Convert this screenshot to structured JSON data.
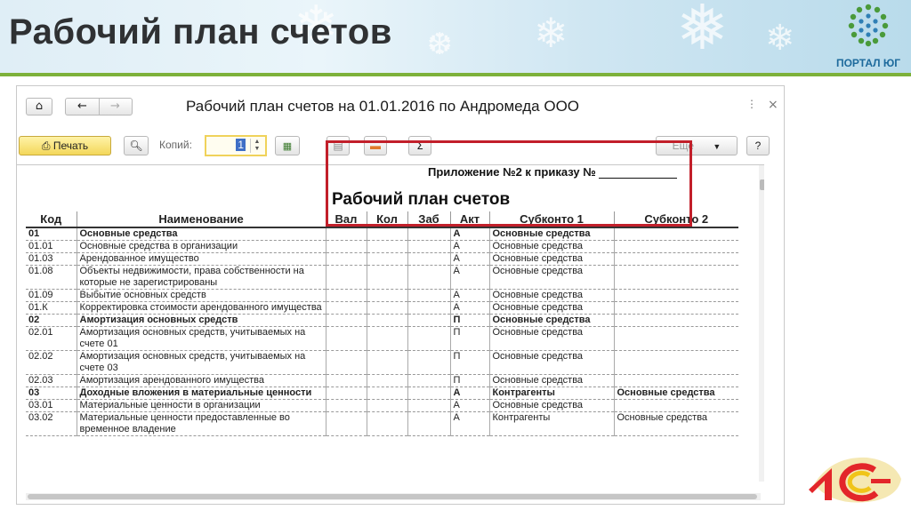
{
  "slide": {
    "title": "Рабочий план счетов",
    "logo_text": "ПОРТАЛ ЮГ",
    "brand_logo_text": "1С",
    "colors": {
      "title": "#2f3133",
      "accent_line": "#7db13a",
      "highlight": "#c21f2a"
    }
  },
  "window": {
    "title": "Рабочий план счетов на 01.01.2016 по Андромеда ООО",
    "nav": {
      "home_icon": "home-icon",
      "back_icon": "arrow-left-icon",
      "forward_icon": "arrow-right-icon"
    },
    "toolbar": {
      "print_label": "Печать",
      "copies_label": "Копий:",
      "copies_value": "1",
      "more_label": "Еще",
      "help_label": "?",
      "icons": [
        "printer-icon",
        "preview-icon",
        "save-icon",
        "table-icon",
        "minus-icon",
        "sum-icon"
      ]
    }
  },
  "sheet": {
    "appendix": "Приложение №2 к приказу №",
    "title": "Рабочий план счетов",
    "columns": [
      "Код",
      "Наименование",
      "Вал",
      "Кол",
      "Заб",
      "Акт",
      "Субконто 1",
      "Субконто 2"
    ],
    "rows": [
      {
        "code": "01",
        "name": "Основные средства",
        "val": "",
        "kol": "",
        "zab": "",
        "akt": "А",
        "sub1": "Основные средства",
        "sub2": "",
        "bold": true
      },
      {
        "code": "01.01",
        "name": "Основные средства в организации",
        "val": "",
        "kol": "",
        "zab": "",
        "akt": "А",
        "sub1": "Основные средства",
        "sub2": "",
        "bold": false
      },
      {
        "code": "01.03",
        "name": "Арендованное имущество",
        "val": "",
        "kol": "",
        "zab": "",
        "akt": "А",
        "sub1": "Основные средства",
        "sub2": "",
        "bold": false
      },
      {
        "code": "01.08",
        "name": "Объекты недвижимости, права собственности на которые не зарегистрированы",
        "val": "",
        "kol": "",
        "zab": "",
        "akt": "А",
        "sub1": "Основные средства",
        "sub2": "",
        "bold": false
      },
      {
        "code": "01.09",
        "name": "Выбытие основных средств",
        "val": "",
        "kol": "",
        "zab": "",
        "akt": "А",
        "sub1": "Основные средства",
        "sub2": "",
        "bold": false
      },
      {
        "code": "01.К",
        "name": "Корректировка стоимости арендованного имущества",
        "val": "",
        "kol": "",
        "zab": "",
        "akt": "А",
        "sub1": "Основные средства",
        "sub2": "",
        "bold": false
      },
      {
        "code": "02",
        "name": "Амортизация основных средств",
        "val": "",
        "kol": "",
        "zab": "",
        "akt": "П",
        "sub1": "Основные средства",
        "sub2": "",
        "bold": true
      },
      {
        "code": "02.01",
        "name": "Амортизация основных средств, учитываемых на счете 01",
        "val": "",
        "kol": "",
        "zab": "",
        "akt": "П",
        "sub1": "Основные средства",
        "sub2": "",
        "bold": false
      },
      {
        "code": "02.02",
        "name": "Амортизация основных средств, учитываемых на счете 03",
        "val": "",
        "kol": "",
        "zab": "",
        "akt": "П",
        "sub1": "Основные средства",
        "sub2": "",
        "bold": false
      },
      {
        "code": "02.03",
        "name": "Амортизация арендованного имущества",
        "val": "",
        "kol": "",
        "zab": "",
        "akt": "П",
        "sub1": "Основные средства",
        "sub2": "",
        "bold": false
      },
      {
        "code": "03",
        "name": "Доходные вложения в материальные ценности",
        "val": "",
        "kol": "",
        "zab": "",
        "akt": "А",
        "sub1": "Контрагенты",
        "sub2": "Основные средства",
        "bold": true
      },
      {
        "code": "03.01",
        "name": "Материальные ценности в организации",
        "val": "",
        "kol": "",
        "zab": "",
        "akt": "А",
        "sub1": "Основные средства",
        "sub2": "",
        "bold": false
      },
      {
        "code": "03.02",
        "name": "Материальные ценности предоставленные во временное владение",
        "val": "",
        "kol": "",
        "zab": "",
        "akt": "А",
        "sub1": "Контрагенты",
        "sub2": "Основные средства",
        "bold": false
      }
    ]
  }
}
